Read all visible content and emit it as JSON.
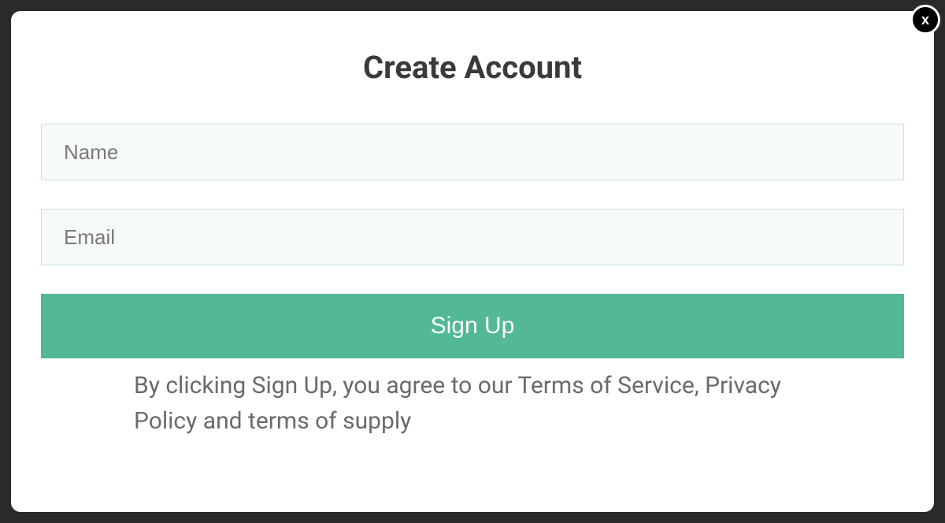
{
  "modal": {
    "title": "Create Account",
    "close_label": "x",
    "fields": {
      "name_placeholder": "Name",
      "email_placeholder": "Email"
    },
    "signup_button": "Sign Up",
    "terms_text": "By clicking Sign Up, you agree to our Terms of Service, Privacy Policy and terms of supply"
  },
  "colors": {
    "accent": "#52b895",
    "background": "#2a2a2a",
    "modal_bg": "#ffffff",
    "input_bg": "#f6f9f9",
    "input_border": "#c4e6db",
    "text_dark": "#3a3a3a",
    "text_muted": "#6a6a6a"
  }
}
